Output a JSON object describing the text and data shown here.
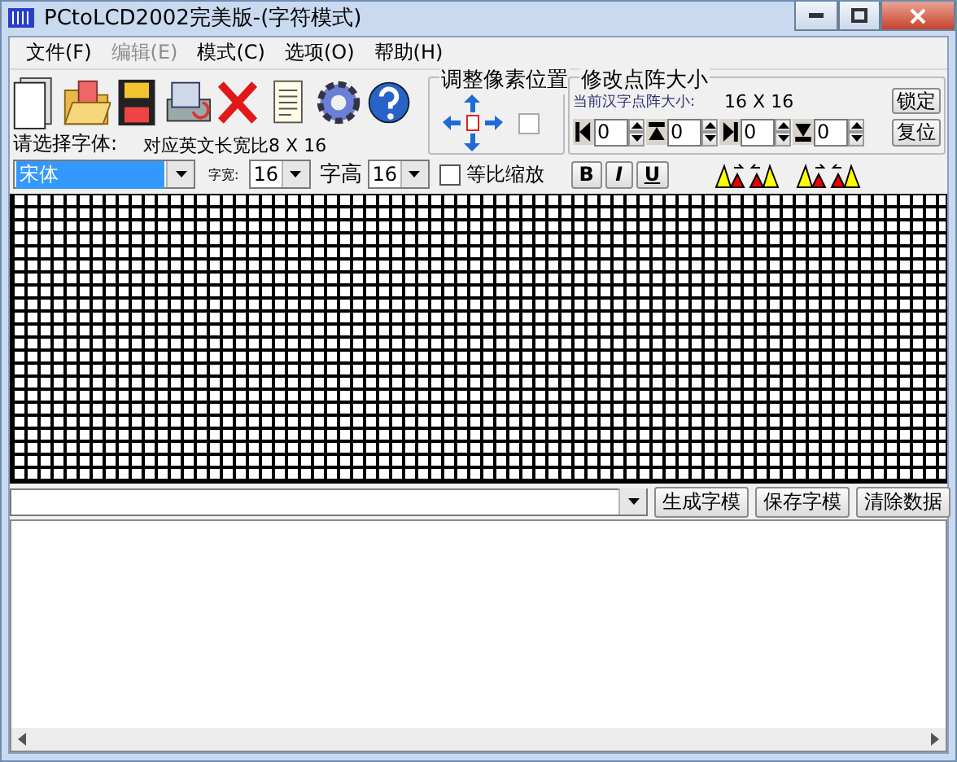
{
  "window": {
    "title": "PCtoLCD2002完美版-(字符模式)"
  },
  "menu": [
    {
      "label": "文件(F)",
      "disabled": false
    },
    {
      "label": "编辑(E)",
      "disabled": true
    },
    {
      "label": "模式(C)",
      "disabled": false
    },
    {
      "label": "选项(O)",
      "disabled": false
    },
    {
      "label": "帮助(H)",
      "disabled": false
    }
  ],
  "font": {
    "label": "请选择字体:",
    "value": "宋体"
  },
  "ratio": "对应英文长宽比8 X 16",
  "char_width": {
    "label": "字宽:",
    "value": "16"
  },
  "char_height": {
    "label": "字高",
    "value": "16"
  },
  "proportional": {
    "label": "等比缩放",
    "checked": false
  },
  "style_buttons": [
    {
      "label": "B",
      "kind": "bold"
    },
    {
      "label": "I",
      "kind": "italic"
    },
    {
      "label": "U",
      "kind": "underline"
    }
  ],
  "pixel_group": {
    "title": "调整像素位置"
  },
  "size_group": {
    "title": "修改点阵大小",
    "current_label": "当前汉字点阵大小:",
    "current_value": "16 X 16",
    "spinners": [
      "0",
      "0",
      "0",
      "0"
    ],
    "lock": "锁定",
    "reset": "复位"
  },
  "output": {
    "buttons": [
      "生成字模",
      "保存字模",
      "清除数据"
    ]
  }
}
